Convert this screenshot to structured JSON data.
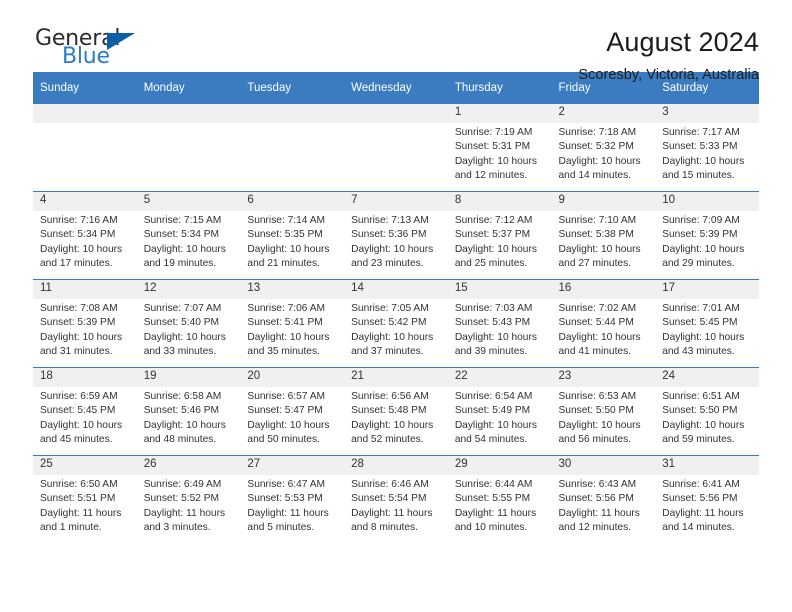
{
  "brand": {
    "name_top": "General",
    "name_bottom": "Blue",
    "triangle_color": "#0b5ea8",
    "blue_color": "#2b7dc3"
  },
  "header": {
    "title": "August 2024",
    "subtitle": "Scoresby, Victoria, Australia"
  },
  "theme": {
    "header_row_bg": "#3a7cbf",
    "header_row_text": "#ffffff",
    "cell_border": "#3a7cbf",
    "shaded_cell_bg": "#f0f0f0"
  },
  "weekdays": [
    "Sunday",
    "Monday",
    "Tuesday",
    "Wednesday",
    "Thursday",
    "Friday",
    "Saturday"
  ],
  "labels": {
    "sunrise_prefix": "Sunrise:",
    "sunset_prefix": "Sunset:",
    "daylight_prefix": "Daylight:"
  },
  "weeks": [
    [
      {
        "day": "",
        "lines": []
      },
      {
        "day": "",
        "lines": []
      },
      {
        "day": "",
        "lines": []
      },
      {
        "day": "",
        "lines": []
      },
      {
        "day": "1",
        "lines": [
          "Sunrise: 7:19 AM",
          "Sunset: 5:31 PM",
          "Daylight: 10 hours",
          "and 12 minutes."
        ]
      },
      {
        "day": "2",
        "lines": [
          "Sunrise: 7:18 AM",
          "Sunset: 5:32 PM",
          "Daylight: 10 hours",
          "and 14 minutes."
        ]
      },
      {
        "day": "3",
        "lines": [
          "Sunrise: 7:17 AM",
          "Sunset: 5:33 PM",
          "Daylight: 10 hours",
          "and 15 minutes."
        ]
      }
    ],
    [
      {
        "day": "4",
        "lines": [
          "Sunrise: 7:16 AM",
          "Sunset: 5:34 PM",
          "Daylight: 10 hours",
          "and 17 minutes."
        ]
      },
      {
        "day": "5",
        "lines": [
          "Sunrise: 7:15 AM",
          "Sunset: 5:34 PM",
          "Daylight: 10 hours",
          "and 19 minutes."
        ]
      },
      {
        "day": "6",
        "lines": [
          "Sunrise: 7:14 AM",
          "Sunset: 5:35 PM",
          "Daylight: 10 hours",
          "and 21 minutes."
        ]
      },
      {
        "day": "7",
        "lines": [
          "Sunrise: 7:13 AM",
          "Sunset: 5:36 PM",
          "Daylight: 10 hours",
          "and 23 minutes."
        ]
      },
      {
        "day": "8",
        "lines": [
          "Sunrise: 7:12 AM",
          "Sunset: 5:37 PM",
          "Daylight: 10 hours",
          "and 25 minutes."
        ]
      },
      {
        "day": "9",
        "lines": [
          "Sunrise: 7:10 AM",
          "Sunset: 5:38 PM",
          "Daylight: 10 hours",
          "and 27 minutes."
        ]
      },
      {
        "day": "10",
        "lines": [
          "Sunrise: 7:09 AM",
          "Sunset: 5:39 PM",
          "Daylight: 10 hours",
          "and 29 minutes."
        ]
      }
    ],
    [
      {
        "day": "11",
        "lines": [
          "Sunrise: 7:08 AM",
          "Sunset: 5:39 PM",
          "Daylight: 10 hours",
          "and 31 minutes."
        ]
      },
      {
        "day": "12",
        "lines": [
          "Sunrise: 7:07 AM",
          "Sunset: 5:40 PM",
          "Daylight: 10 hours",
          "and 33 minutes."
        ]
      },
      {
        "day": "13",
        "lines": [
          "Sunrise: 7:06 AM",
          "Sunset: 5:41 PM",
          "Daylight: 10 hours",
          "and 35 minutes."
        ]
      },
      {
        "day": "14",
        "lines": [
          "Sunrise: 7:05 AM",
          "Sunset: 5:42 PM",
          "Daylight: 10 hours",
          "and 37 minutes."
        ]
      },
      {
        "day": "15",
        "lines": [
          "Sunrise: 7:03 AM",
          "Sunset: 5:43 PM",
          "Daylight: 10 hours",
          "and 39 minutes."
        ]
      },
      {
        "day": "16",
        "lines": [
          "Sunrise: 7:02 AM",
          "Sunset: 5:44 PM",
          "Daylight: 10 hours",
          "and 41 minutes."
        ]
      },
      {
        "day": "17",
        "lines": [
          "Sunrise: 7:01 AM",
          "Sunset: 5:45 PM",
          "Daylight: 10 hours",
          "and 43 minutes."
        ]
      }
    ],
    [
      {
        "day": "18",
        "lines": [
          "Sunrise: 6:59 AM",
          "Sunset: 5:45 PM",
          "Daylight: 10 hours",
          "and 45 minutes."
        ]
      },
      {
        "day": "19",
        "lines": [
          "Sunrise: 6:58 AM",
          "Sunset: 5:46 PM",
          "Daylight: 10 hours",
          "and 48 minutes."
        ]
      },
      {
        "day": "20",
        "lines": [
          "Sunrise: 6:57 AM",
          "Sunset: 5:47 PM",
          "Daylight: 10 hours",
          "and 50 minutes."
        ]
      },
      {
        "day": "21",
        "lines": [
          "Sunrise: 6:56 AM",
          "Sunset: 5:48 PM",
          "Daylight: 10 hours",
          "and 52 minutes."
        ]
      },
      {
        "day": "22",
        "lines": [
          "Sunrise: 6:54 AM",
          "Sunset: 5:49 PM",
          "Daylight: 10 hours",
          "and 54 minutes."
        ]
      },
      {
        "day": "23",
        "lines": [
          "Sunrise: 6:53 AM",
          "Sunset: 5:50 PM",
          "Daylight: 10 hours",
          "and 56 minutes."
        ]
      },
      {
        "day": "24",
        "lines": [
          "Sunrise: 6:51 AM",
          "Sunset: 5:50 PM",
          "Daylight: 10 hours",
          "and 59 minutes."
        ]
      }
    ],
    [
      {
        "day": "25",
        "lines": [
          "Sunrise: 6:50 AM",
          "Sunset: 5:51 PM",
          "Daylight: 11 hours",
          "and 1 minute."
        ]
      },
      {
        "day": "26",
        "lines": [
          "Sunrise: 6:49 AM",
          "Sunset: 5:52 PM",
          "Daylight: 11 hours",
          "and 3 minutes."
        ]
      },
      {
        "day": "27",
        "lines": [
          "Sunrise: 6:47 AM",
          "Sunset: 5:53 PM",
          "Daylight: 11 hours",
          "and 5 minutes."
        ]
      },
      {
        "day": "28",
        "lines": [
          "Sunrise: 6:46 AM",
          "Sunset: 5:54 PM",
          "Daylight: 11 hours",
          "and 8 minutes."
        ]
      },
      {
        "day": "29",
        "lines": [
          "Sunrise: 6:44 AM",
          "Sunset: 5:55 PM",
          "Daylight: 11 hours",
          "and 10 minutes."
        ]
      },
      {
        "day": "30",
        "lines": [
          "Sunrise: 6:43 AM",
          "Sunset: 5:56 PM",
          "Daylight: 11 hours",
          "and 12 minutes."
        ]
      },
      {
        "day": "31",
        "lines": [
          "Sunrise: 6:41 AM",
          "Sunset: 5:56 PM",
          "Daylight: 11 hours",
          "and 14 minutes."
        ]
      }
    ]
  ]
}
